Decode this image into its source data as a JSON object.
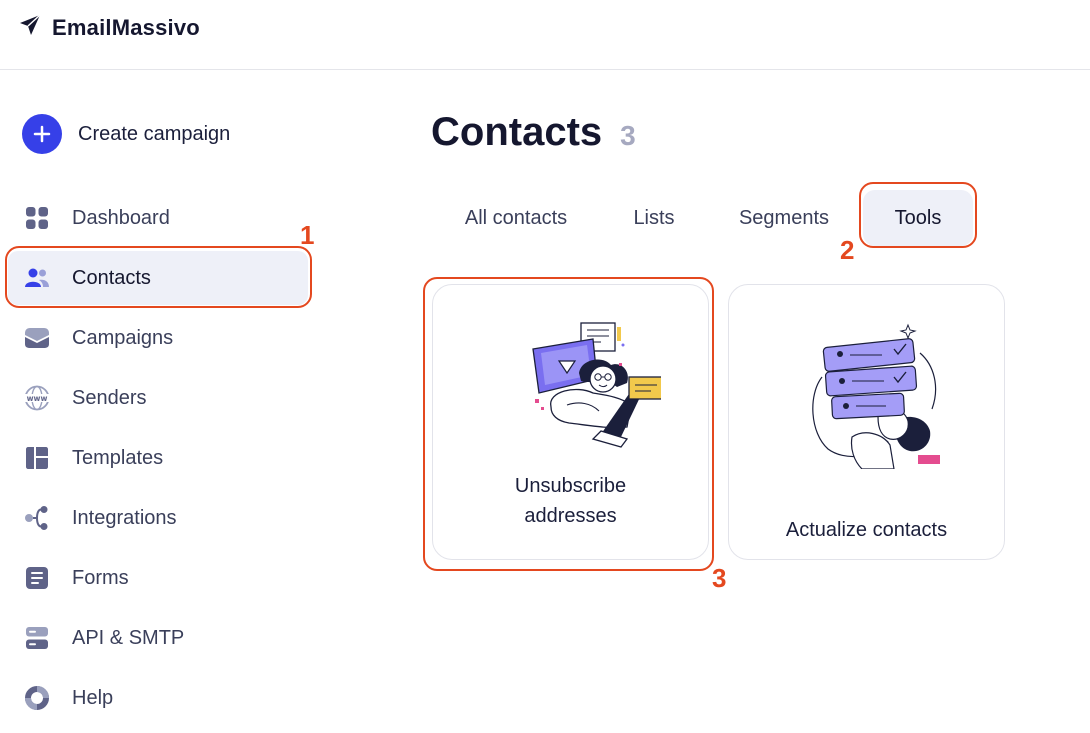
{
  "app": {
    "name": "EmailMassivo"
  },
  "sidebar": {
    "create_label": "Create campaign",
    "items": [
      {
        "label": "Dashboard",
        "icon": "dashboard-icon"
      },
      {
        "label": "Contacts",
        "icon": "contacts-icon",
        "active": true
      },
      {
        "label": "Campaigns",
        "icon": "campaigns-icon"
      },
      {
        "label": "Senders",
        "icon": "www-icon"
      },
      {
        "label": "Templates",
        "icon": "templates-icon"
      },
      {
        "label": "Integrations",
        "icon": "integrations-icon"
      },
      {
        "label": "Forms",
        "icon": "forms-icon"
      },
      {
        "label": "API & SMTP",
        "icon": "server-icon"
      },
      {
        "label": "Help",
        "icon": "help-icon"
      }
    ]
  },
  "main": {
    "title": "Contacts",
    "count": "3",
    "tabs": [
      {
        "label": "All contacts"
      },
      {
        "label": "Lists"
      },
      {
        "label": "Segments"
      },
      {
        "label": "Tools",
        "active": true
      }
    ],
    "cards": [
      {
        "label_line1": "Unsubscribe",
        "label_line2": "addresses",
        "illustration": "person-with-laptop-illustration"
      },
      {
        "label": "Actualize contacts",
        "illustration": "person-with-contact-cards-illustration"
      }
    ]
  },
  "annotations": [
    {
      "number": "1",
      "target": "Contacts"
    },
    {
      "number": "2",
      "target": "Tools"
    },
    {
      "number": "3",
      "target": "Unsubscribe addresses"
    }
  ],
  "colors": {
    "accent": "#3640e8",
    "callout": "#e4481f",
    "active_bg": "#eef0f8",
    "icon": "#5f6388"
  }
}
